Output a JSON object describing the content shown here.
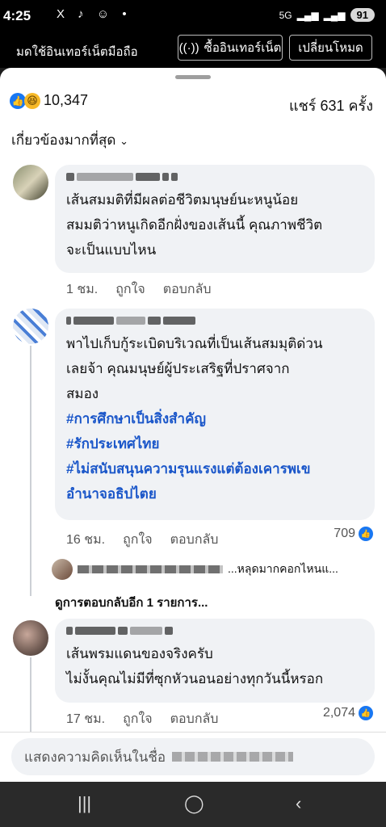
{
  "status": {
    "time": "4:25",
    "network": "5G",
    "battery": "91",
    "notif_icons": "X ♪ ☺ •"
  },
  "mode_bar": {
    "message": "มดใช้อินเทอร์เน็ตมือถือ",
    "buy_label": "ซื้ออินเทอร์เน็ต",
    "switch_label": "เปลี่ยนโหมด"
  },
  "summary": {
    "reaction_count": "10,347",
    "shares": "แชร์ 631 ครั้ง"
  },
  "sort_label": "เกี่ยวข้องมากที่สุด",
  "comments": [
    {
      "lines": [
        "เส้นสมมติที่มีผลต่อชีวิตมนุษย์นะหนูน้อย",
        "สมมติว่าหนูเกิดอีกฝั่งของเส้นนี้ คุณภาพชีวิต",
        "จะเป็นแบบไหน"
      ],
      "time": "1 ชม.",
      "like": "ถูกใจ",
      "reply": "ตอบกลับ"
    },
    {
      "lines": [
        "พาไปเก็บกู้ระเบิดบริเวณที่เป็นเส้นสมมุติด่วน",
        "เลยจ้า คุณมนุษย์ผู้ประเสริฐที่ปราศจาก",
        "สมอง"
      ],
      "hashtags": [
        "#การศึกษาเป็นสิ่งสำคัญ",
        "#รักประเทศไทย",
        "#ไม่สนับสนุนความรุนแรงแต่ต้องเคารพเข",
        "อำนาจอธิปไตย"
      ],
      "time": "16 ชม.",
      "like": "ถูกใจ",
      "reply": "ตอบกลับ",
      "reactions": "709"
    },
    {
      "lines": [
        "เส้นพรมแดนของจริงครับ",
        "ไม่งั้นคุณไม่มีที่ซุกหัวนอนอย่างทุกวันนี้หรอก"
      ],
      "time": "17 ชม.",
      "like": "ถูกใจ",
      "reply": "ตอบกลับ",
      "reactions": "2,074"
    }
  ],
  "reply_preview": "...หลุดมากคอกไหนแ...",
  "more_replies": "ดูการตอบกลับอีก 1 รายการ...",
  "input_placeholder": "แสดงความคิดเห็นในชื่อ"
}
